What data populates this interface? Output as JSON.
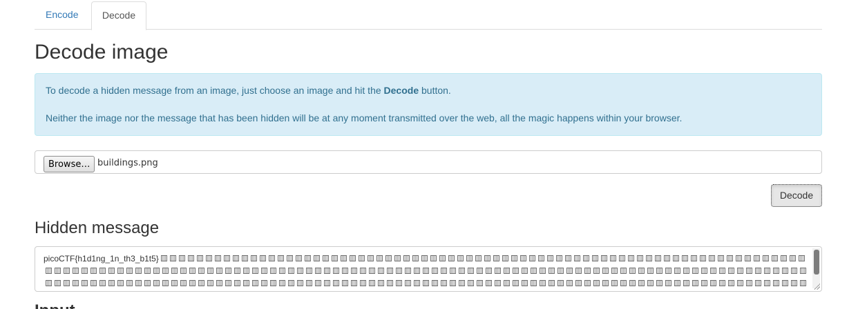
{
  "tabs": [
    {
      "label": "Encode",
      "active": false
    },
    {
      "label": "Decode",
      "active": true
    }
  ],
  "page_title": "Decode image",
  "info": {
    "line1_before": "To decode a hidden message from an image, just choose an image and hit the ",
    "line1_bold": "Decode",
    "line1_after": " button.",
    "line2": "Neither the image nor the message that has been hidden will be at any moment transmitted over the web, all the magic happens within your browser."
  },
  "file_input": {
    "button_label": "Browse…",
    "file_name": "buildings.png"
  },
  "decode_button": "Decode",
  "hidden_message": {
    "heading": "Hidden message",
    "text": "picoCTF{h1d1ng_1n_th3_b1t5}"
  },
  "next_heading": "Input",
  "colors": {
    "link": "#337ab7",
    "info_bg": "#d9edf7",
    "info_text": "#31708f",
    "border": "#dddddd"
  }
}
